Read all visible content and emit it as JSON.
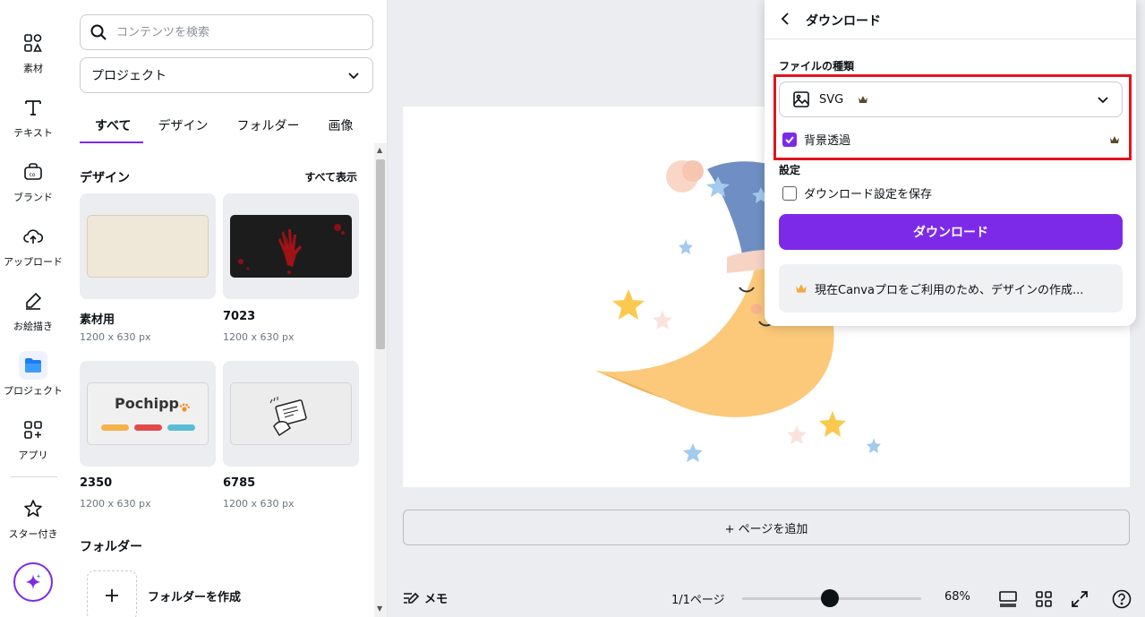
{
  "rail": {
    "items": [
      {
        "label": "素材",
        "icon": "elements-icon"
      },
      {
        "label": "テキスト",
        "icon": "text-icon"
      },
      {
        "label": "ブランド",
        "icon": "brand-icon"
      },
      {
        "label": "アップロード",
        "icon": "upload-icon"
      },
      {
        "label": "お絵描き",
        "icon": "draw-icon"
      },
      {
        "label": "プロジェクト",
        "icon": "folder-icon"
      },
      {
        "label": "アプリ",
        "icon": "apps-icon"
      },
      {
        "label": "スター付き",
        "icon": "star-icon"
      }
    ],
    "active": "プロジェクト"
  },
  "panel": {
    "search_placeholder": "コンテンツを検索",
    "project_select": "プロジェクト",
    "tabs": [
      "すべて",
      "デザイン",
      "フォルダー",
      "画像"
    ],
    "active_tab": "すべて",
    "design_section": "デザイン",
    "see_all": "すべて表示",
    "designs": [
      {
        "name": "素材用",
        "size": "1200 x 630 px"
      },
      {
        "name": "7023",
        "size": "1200 x 630 px"
      },
      {
        "name": "2350",
        "size": "1200 x 630 px"
      },
      {
        "name": "6785",
        "size": "1200 x 630 px"
      }
    ],
    "thumb_text": {
      "pochipp": "Pochipp"
    },
    "folder_section": "フォルダー",
    "create_folder": "フォルダーを作成"
  },
  "workspace": {
    "add_page": "+ ページを追加",
    "memo": "メモ",
    "page_count": "1/1ページ",
    "zoom": "68%",
    "zoom_fraction": 0.49
  },
  "download": {
    "title": "ダウンロード",
    "file_type_label": "ファイルの種類",
    "file_type_value": "SVG",
    "transparent_bg": "背景透過",
    "transparent_checked": true,
    "settings_label": "設定",
    "save_settings": "ダウンロード設定を保存",
    "save_settings_checked": false,
    "download_button": "ダウンロード",
    "promo_text": "現在Canvaプロをご利用のため、デザインの作成..."
  },
  "colors": {
    "accent": "#7d2ae8",
    "highlight_box": "#e0141e",
    "crown": "#6b4e00"
  }
}
